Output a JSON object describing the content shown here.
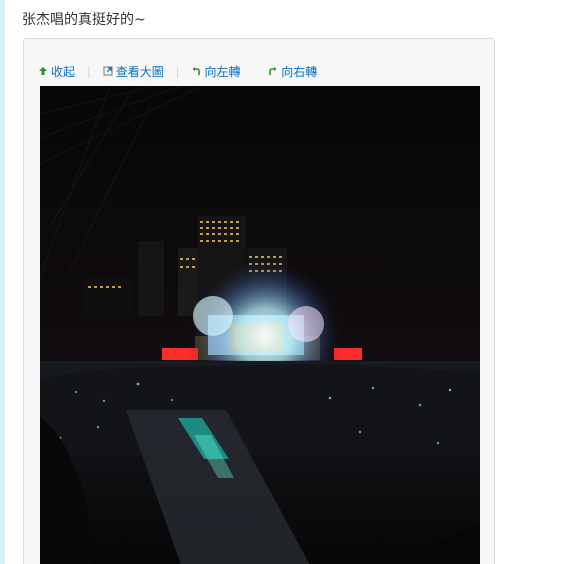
{
  "post": {
    "text": "张杰唱的真挺好的~"
  },
  "toolbar": {
    "collapse_label": "收起",
    "view_large_label": "查看大圖",
    "rotate_left_label": "向左轉",
    "rotate_right_label": "向右轉",
    "separator": "|"
  },
  "photo": {
    "alt": "Night concert stadium photo with a brightly lit stage, crowd and city skyline"
  },
  "colors": {
    "link": "#0a6fc2",
    "icon_green": "#2f8f2f",
    "box_border": "#dcdcdc",
    "box_background": "#f7f7f7",
    "rail": "#d9eef8"
  }
}
